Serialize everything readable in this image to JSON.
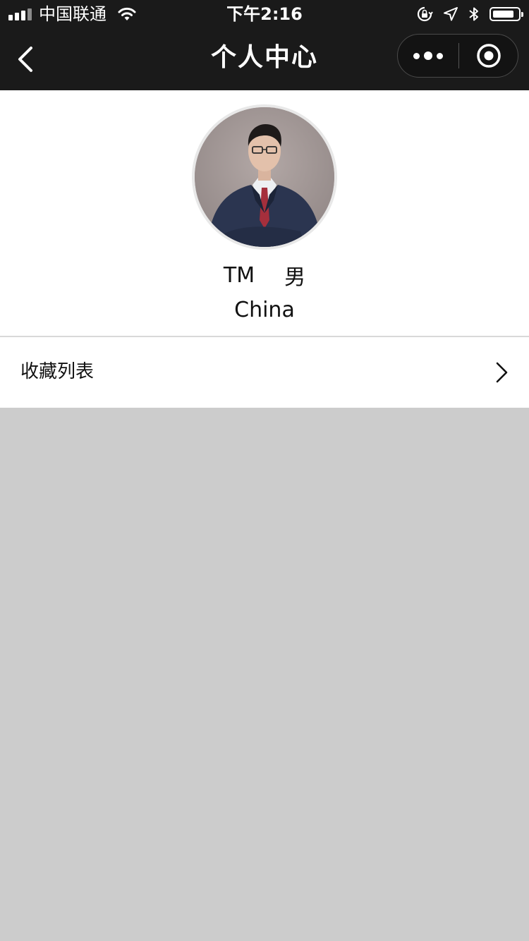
{
  "status_bar": {
    "carrier": "中国联通",
    "time": "下午2:16",
    "icons": [
      "signal-icon",
      "wifi-icon",
      "orientation-lock-icon",
      "location-icon",
      "bluetooth-icon",
      "battery-icon"
    ]
  },
  "nav": {
    "title": "个人中心",
    "back_icon": "chevron-left-icon",
    "more_icon": "more-dots-icon",
    "close_icon": "target-close-icon"
  },
  "profile": {
    "name": "TM",
    "gender": "男",
    "region": "China",
    "avatar": "avatar-photo"
  },
  "menu": {
    "items": [
      {
        "label": "收藏列表",
        "icon": "chevron-right-icon"
      }
    ]
  },
  "colors": {
    "bar_background": "#1a1a1a",
    "page_background": "#cccccc",
    "card_background": "#ffffff",
    "text": "#111111"
  }
}
